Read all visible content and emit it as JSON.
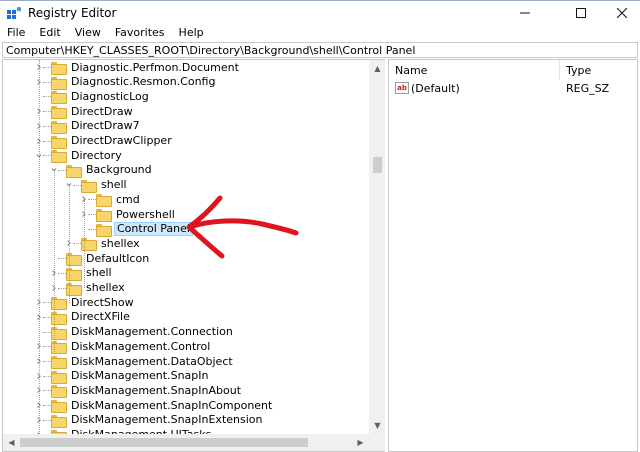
{
  "window": {
    "title": "Registry Editor"
  },
  "menu": [
    "File",
    "Edit",
    "View",
    "Favorites",
    "Help"
  ],
  "address": "Computer\\HKEY_CLASSES_ROOT\\Directory\\Background\\shell\\Control Panel",
  "tree": [
    {
      "label": "Diagnostic.Perfmon.Document",
      "depth": 0,
      "expander": "collapsed"
    },
    {
      "label": "Diagnostic.Resmon.Config",
      "depth": 0,
      "expander": "collapsed"
    },
    {
      "label": "DiagnosticLog",
      "depth": 0,
      "expander": "none"
    },
    {
      "label": "DirectDraw",
      "depth": 0,
      "expander": "collapsed"
    },
    {
      "label": "DirectDraw7",
      "depth": 0,
      "expander": "collapsed"
    },
    {
      "label": "DirectDrawClipper",
      "depth": 0,
      "expander": "collapsed"
    },
    {
      "label": "Directory",
      "depth": 0,
      "expander": "expanded"
    },
    {
      "label": "Background",
      "depth": 1,
      "expander": "expanded"
    },
    {
      "label": "shell",
      "depth": 2,
      "expander": "expanded"
    },
    {
      "label": "cmd",
      "depth": 3,
      "expander": "collapsed"
    },
    {
      "label": "Powershell",
      "depth": 3,
      "expander": "collapsed"
    },
    {
      "label": "Control Panel",
      "depth": 3,
      "expander": "none",
      "selected": true
    },
    {
      "label": "shellex",
      "depth": 2,
      "expander": "collapsed"
    },
    {
      "label": "DefaultIcon",
      "depth": 1,
      "expander": "none"
    },
    {
      "label": "shell",
      "depth": 1,
      "expander": "collapsed"
    },
    {
      "label": "shellex",
      "depth": 1,
      "expander": "collapsed"
    },
    {
      "label": "DirectShow",
      "depth": 0,
      "expander": "collapsed"
    },
    {
      "label": "DirectXFile",
      "depth": 0,
      "expander": "collapsed"
    },
    {
      "label": "DiskManagement.Connection",
      "depth": 0,
      "expander": "none"
    },
    {
      "label": "DiskManagement.Control",
      "depth": 0,
      "expander": "collapsed"
    },
    {
      "label": "DiskManagement.DataObject",
      "depth": 0,
      "expander": "collapsed"
    },
    {
      "label": "DiskManagement.SnapIn",
      "depth": 0,
      "expander": "collapsed"
    },
    {
      "label": "DiskManagement.SnapInAbout",
      "depth": 0,
      "expander": "collapsed"
    },
    {
      "label": "DiskManagement.SnapInComponent",
      "depth": 0,
      "expander": "collapsed"
    },
    {
      "label": "DiskManagement.SnapInExtension",
      "depth": 0,
      "expander": "collapsed"
    },
    {
      "label": "DiskManagement.UITasks",
      "depth": 0,
      "expander": "collapsed"
    }
  ],
  "values_pane": {
    "columns": {
      "name": "Name",
      "type": "Type"
    },
    "rows": [
      {
        "name": "(Default)",
        "type": "REG_SZ",
        "icon": "string-value-icon"
      }
    ]
  },
  "colors": {
    "annotation": "#e0141e",
    "selection": "#cce8ff",
    "folder": "#f7d56a"
  }
}
